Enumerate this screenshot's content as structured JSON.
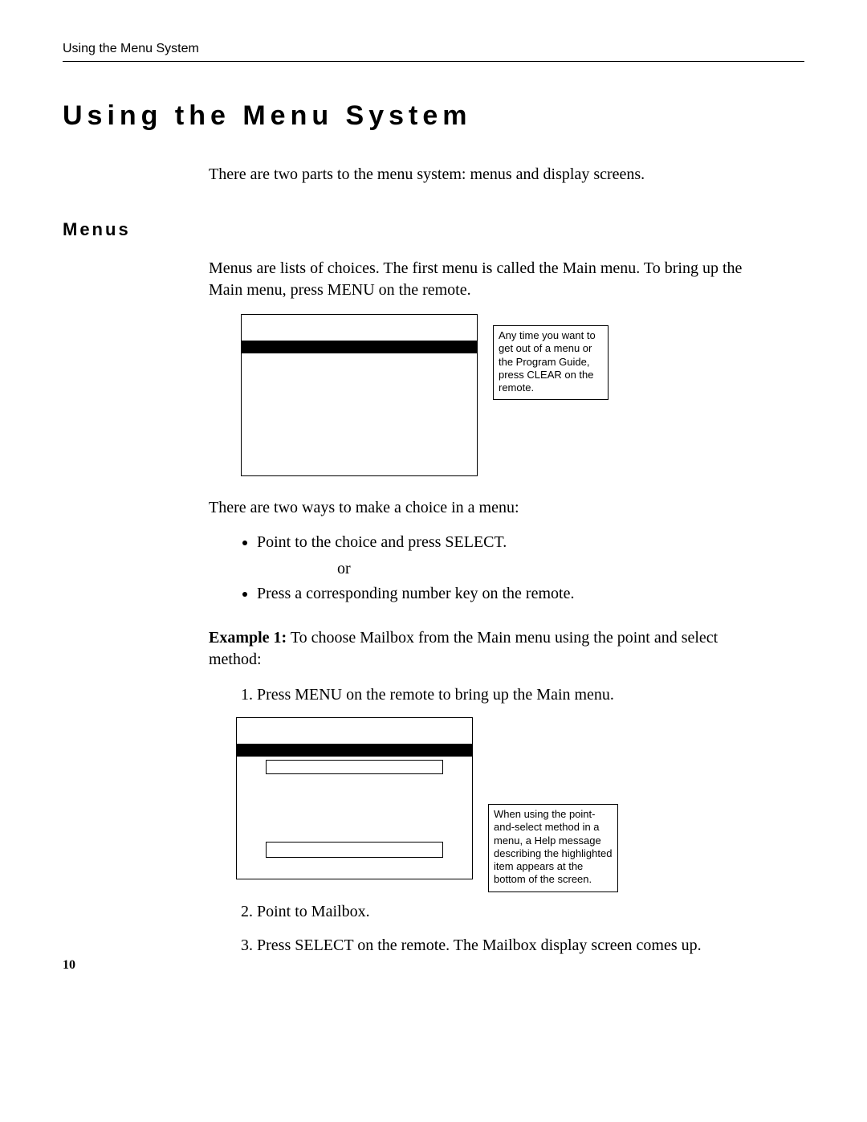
{
  "running_head": "Using the Menu System",
  "page_title": "Using the Menu System",
  "intro_line": "There are two parts to the menu system: menus and display screens.",
  "section_heading": "Menus",
  "menus_para": "Menus are lists of choices. The first menu is called the Main menu. To bring up the Main menu, press MENU on the remote.",
  "callout_a": "Any time you want to get out of a menu or the Program Guide,  press CLEAR on the remote.",
  "two_ways_line": "There are two ways to make a choice in a menu:",
  "bullet_1": "Point to the choice and press SELECT.",
  "bullet_or": "or",
  "bullet_2": "Press a corresponding number key on the remote.",
  "example1_prefix": "Example 1:",
  "example1_text": " To choose Mailbox from the Main menu using the point and select method:",
  "step1": "Press MENU on the remote to bring up the Main menu.",
  "callout_b": "When using the point-and-select method in a menu, a Help message describing the highlighted item appears at the bottom of the screen.",
  "step2": "Point to Mailbox.",
  "step3": "Press SELECT on the remote. The Mailbox display screen comes up.",
  "page_number": "10"
}
